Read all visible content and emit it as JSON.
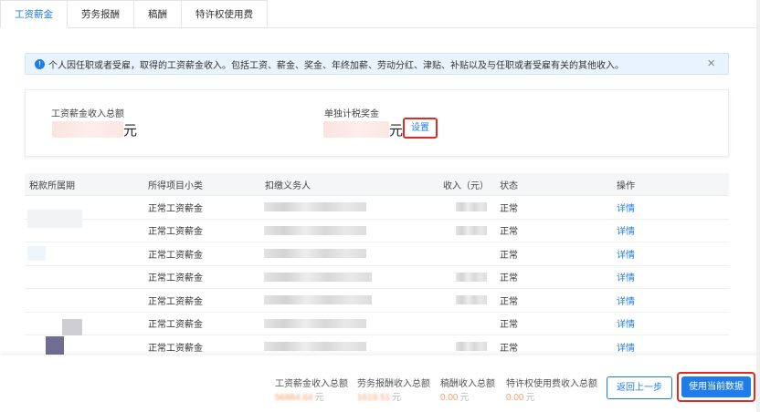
{
  "tabs": [
    {
      "label": "工资薪金",
      "active": true
    },
    {
      "label": "劳务报酬",
      "active": false
    },
    {
      "label": "稿酬",
      "active": false
    },
    {
      "label": "特许权使用费",
      "active": false
    }
  ],
  "notice": {
    "text": "个人因任职或者受雇，取得的工资薪金收入。包括工资、薪金、奖金、年终加薪、劳动分红、津贴、补贴以及与任职或者受雇有关的其他收入。",
    "close": "×"
  },
  "summary": {
    "total_label": "工资薪金收入总额",
    "total_unit": "元",
    "bonus_label": "单独计税奖金",
    "bonus_unit": "元",
    "settings_label": "设置"
  },
  "table": {
    "headers": [
      "税款所属期",
      "所得项目小类",
      "扣缴义务人",
      "收入（元）",
      "状态",
      "操作"
    ],
    "rows": [
      {
        "category": "正常工资薪金",
        "status": "正常",
        "action": "详情"
      },
      {
        "category": "正常工资薪金",
        "status": "正常",
        "action": "详情"
      },
      {
        "category": "正常工资薪金",
        "status": "正常",
        "action": "详情"
      },
      {
        "category": "正常工资薪金",
        "status": "正常",
        "action": "详情"
      },
      {
        "category": "正常工资薪金",
        "status": "正常",
        "action": "详情"
      },
      {
        "category": "正常工资薪金",
        "status": "正常",
        "action": "详情"
      },
      {
        "category": "正常工资薪金",
        "status": "正常",
        "action": "详情"
      }
    ]
  },
  "footer": {
    "items": [
      {
        "label": "工资薪金收入总额",
        "value": "56884.64",
        "unit": "元"
      },
      {
        "label": "劳务报酬收入总额",
        "value": "1619.51",
        "unit": "元"
      },
      {
        "label": "稿酬收入总额",
        "value": "0.00",
        "unit": "元"
      },
      {
        "label": "特许权使用费收入总额",
        "value": "0.00",
        "unit": "元"
      }
    ],
    "back_label": "返回上一步",
    "use_label": "使用当前数据"
  },
  "colors": {
    "accent": "#1f7ce8",
    "highlight_border": "#e02a24",
    "value_orange": "#f0a070"
  }
}
